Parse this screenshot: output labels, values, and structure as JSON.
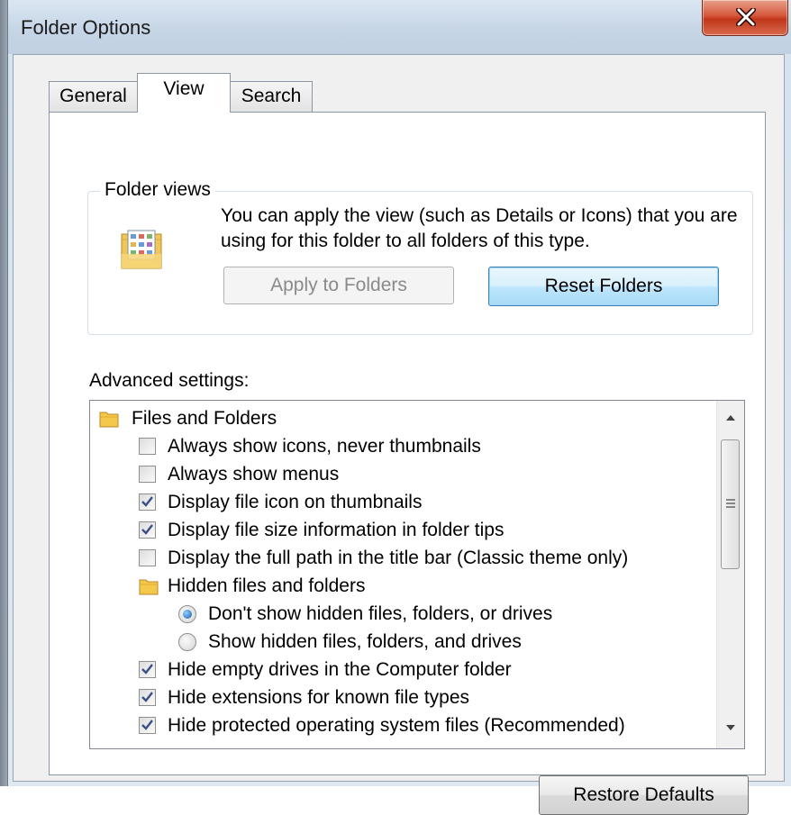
{
  "window": {
    "title": "Folder Options"
  },
  "tabs": [
    {
      "label": "General"
    },
    {
      "label": "View"
    },
    {
      "label": "Search"
    }
  ],
  "folder_views": {
    "group_label": "Folder views",
    "description": "You can apply the view (such as Details or Icons) that you are using for this folder to all folders of this type.",
    "apply_label": "Apply to Folders",
    "reset_label": "Reset Folders"
  },
  "advanced": {
    "label": "Advanced settings:",
    "items": [
      {
        "label": "Files and Folders",
        "kind": "folder"
      },
      {
        "label": "Always show icons, never thumbnails",
        "kind": "checkbox",
        "checked": false
      },
      {
        "label": "Always show menus",
        "kind": "checkbox",
        "checked": false
      },
      {
        "label": "Display file icon on thumbnails",
        "kind": "checkbox",
        "checked": true
      },
      {
        "label": "Display file size information in folder tips",
        "kind": "checkbox",
        "checked": true
      },
      {
        "label": "Display the full path in the title bar (Classic theme only)",
        "kind": "checkbox",
        "checked": false
      },
      {
        "label": "Hidden files and folders",
        "kind": "folder"
      },
      {
        "label": "Don't show hidden files, folders, or drives",
        "kind": "radio",
        "checked": true
      },
      {
        "label": "Show hidden files, folders, and drives",
        "kind": "radio",
        "checked": false
      },
      {
        "label": "Hide empty drives in the Computer folder",
        "kind": "checkbox",
        "checked": true
      },
      {
        "label": "Hide extensions for known file types",
        "kind": "checkbox",
        "checked": true
      },
      {
        "label": "Hide protected operating system files (Recommended)",
        "kind": "checkbox",
        "checked": true
      }
    ]
  },
  "restore_label": "Restore Defaults",
  "icons": {
    "close": "close-x-icon",
    "folder": "folder-icon",
    "folder_views": "folder-view-grid-icon",
    "scroll_up": "scroll-up-arrow-icon",
    "scroll_down": "scroll-down-arrow-icon",
    "grip": "scroll-grip-icon"
  },
  "colors": {
    "close_button": "#c8401f",
    "focused_button": "#bee6fd",
    "checkmark": "#3a4e86",
    "radio_dot": "#1a5aa8",
    "folder_yellow": "#f4c84a"
  }
}
